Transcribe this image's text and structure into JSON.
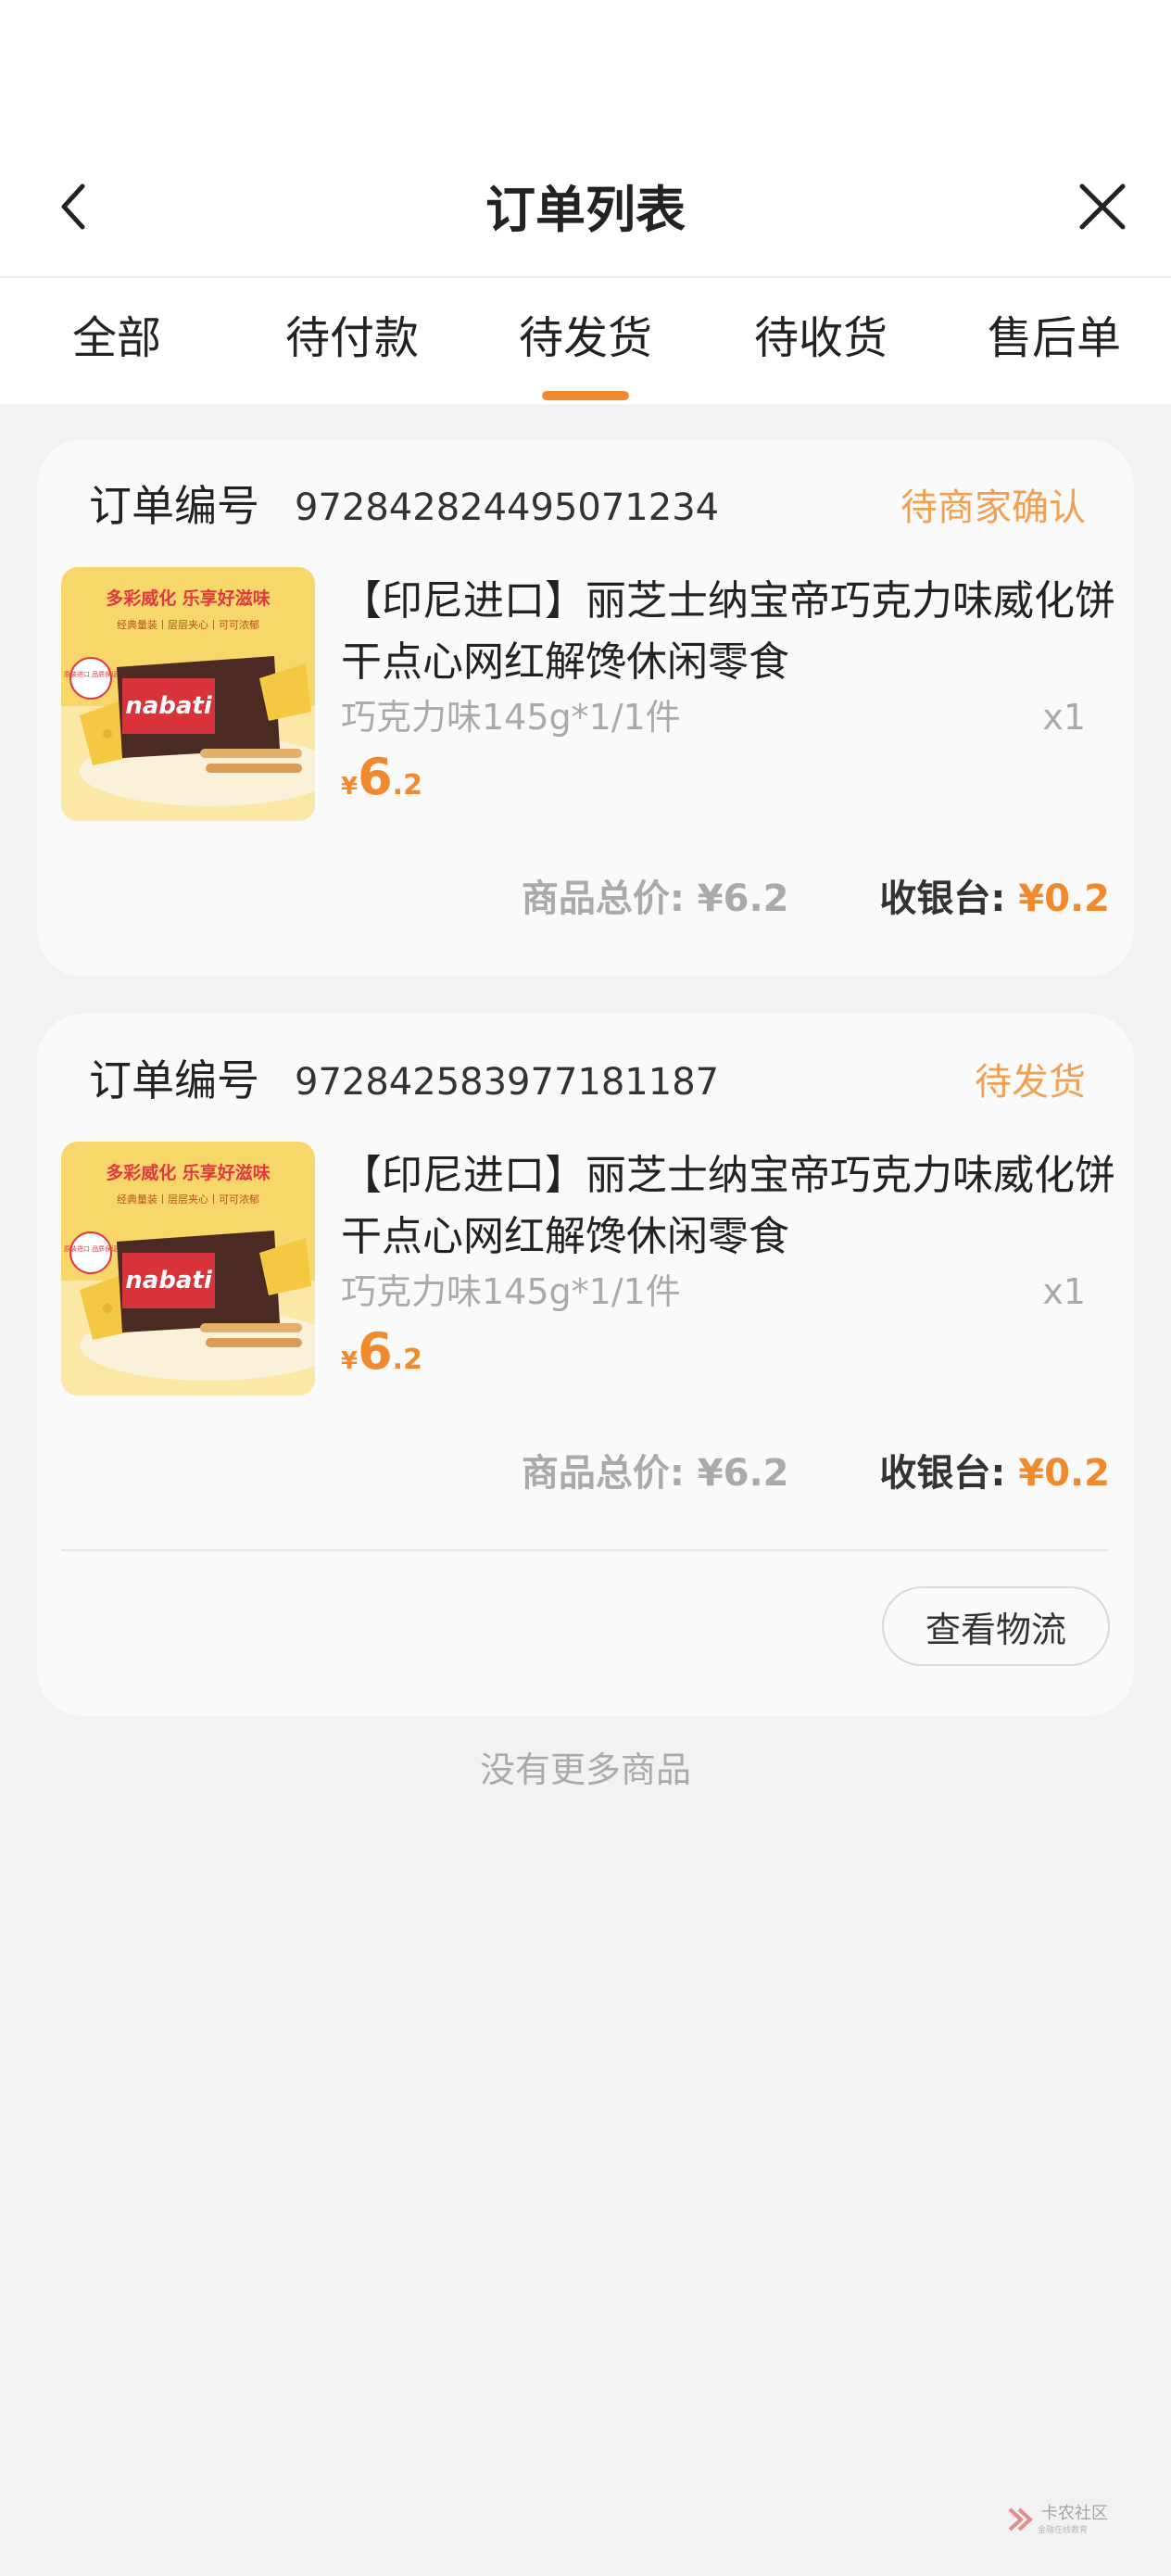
{
  "header": {
    "title": "订单列表"
  },
  "tabs": [
    {
      "label": "全部"
    },
    {
      "label": "待付款"
    },
    {
      "label": "待发货"
    },
    {
      "label": "待收货"
    },
    {
      "label": "售后单"
    }
  ],
  "active_tab": "待发货",
  "orders": [
    {
      "label": "订单编号",
      "number": "972842824495071234",
      "status": "待商家确认",
      "product": {
        "title": "【印尼进口】丽芝士纳宝帝巧克力味威化饼干点心网红解馋休闲零食",
        "spec": "巧克力味145g*1/1件",
        "qty": "x1",
        "price_symbol": "¥",
        "price_int": "6",
        "price_dec": ".2",
        "image": {
          "banner": "多彩威化 乐享好滋味",
          "subtitle": "经典量装丨层层夹心丨可可浓郁",
          "brand": "nabati",
          "badge": "原装进口 品质保证"
        }
      },
      "goods_total_label": "商品总价:",
      "goods_total_value": "¥6.2",
      "checkout_label": "收银台:",
      "checkout_value": "¥0.2"
    },
    {
      "label": "订单编号",
      "number": "972842583977181187",
      "status": "待发货",
      "product": {
        "title": "【印尼进口】丽芝士纳宝帝巧克力味威化饼干点心网红解馋休闲零食",
        "spec": "巧克力味145g*1/1件",
        "qty": "x1",
        "price_symbol": "¥",
        "price_int": "6",
        "price_dec": ".2",
        "image": {
          "banner": "多彩威化 乐享好滋味",
          "subtitle": "经典量装丨层层夹心丨可可浓郁",
          "brand": "nabati",
          "badge": "原装进口 品质保证"
        }
      },
      "goods_total_label": "商品总价:",
      "goods_total_value": "¥6.2",
      "checkout_label": "收银台:",
      "checkout_value": "¥0.2",
      "logistics_button": "查看物流"
    }
  ],
  "footer": {
    "no_more": "没有更多商品"
  },
  "watermark": {
    "text": "卡农社区",
    "sub": "金融在线教育"
  },
  "colors": {
    "accent": "#f08a2c",
    "status": "#f0a050",
    "background": "#f2f2f2"
  }
}
